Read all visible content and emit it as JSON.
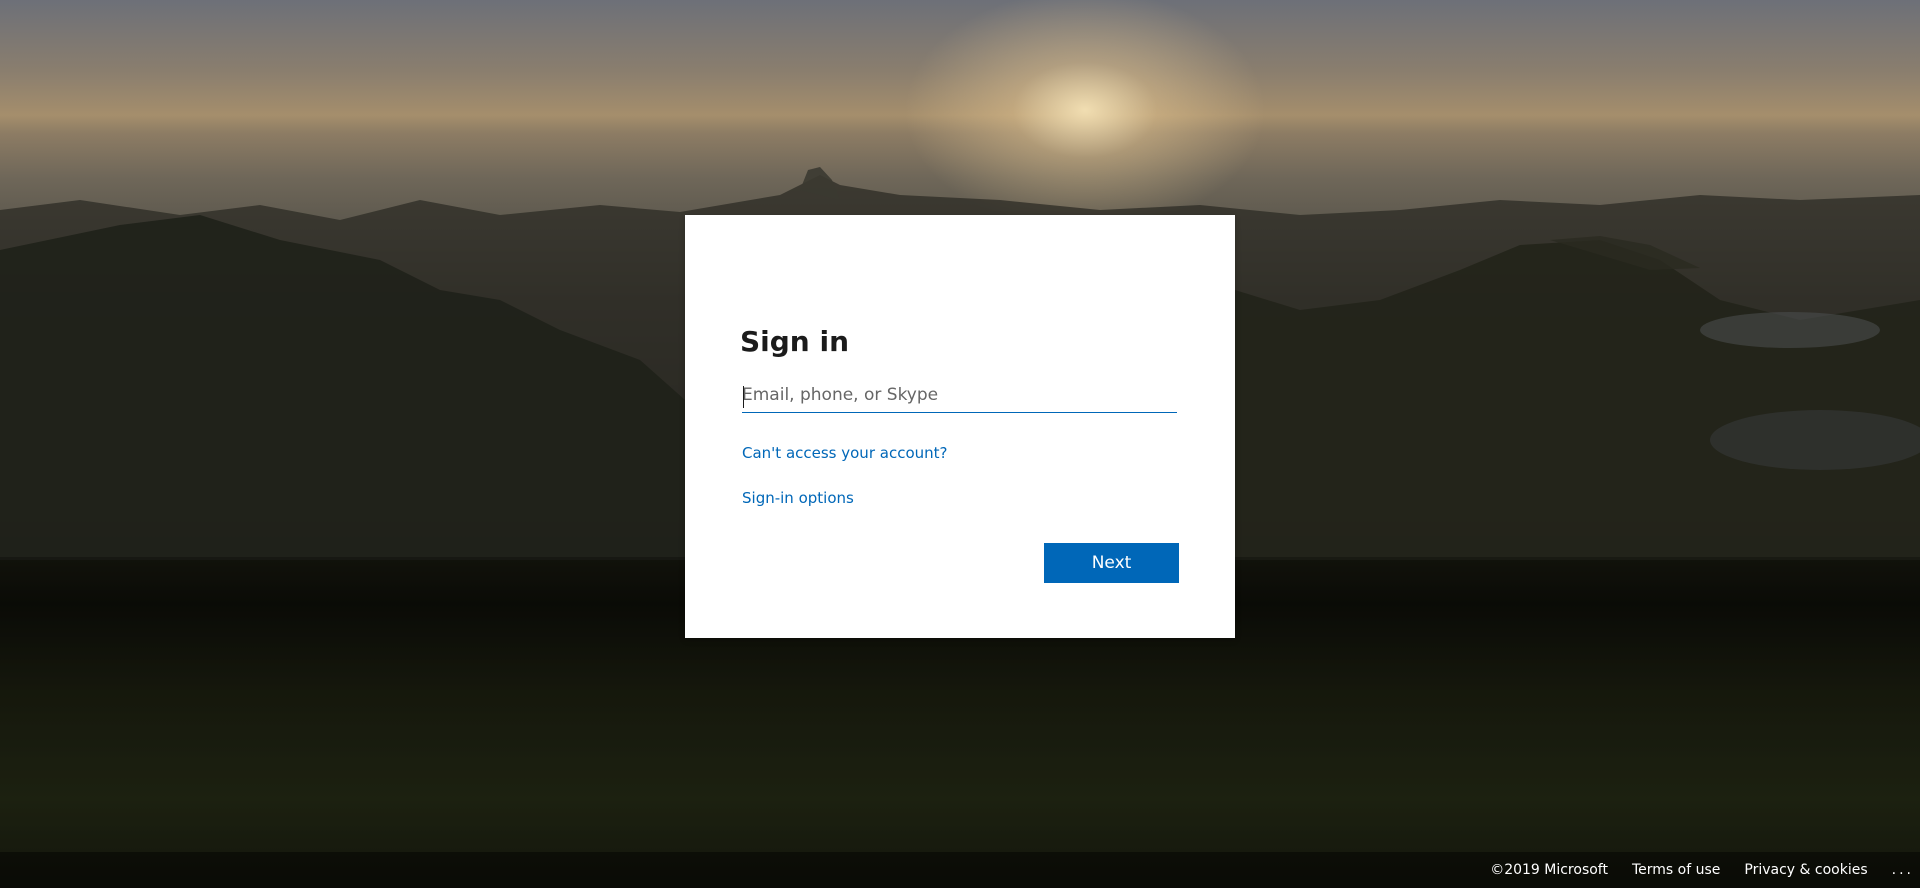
{
  "signin": {
    "title": "Sign in",
    "email_placeholder": "Email, phone, or Skype",
    "email_value": "",
    "cant_access_link": "Can't access your account?",
    "signin_options_link": "Sign-in options",
    "next_button": "Next"
  },
  "footer": {
    "copyright": "©2019 Microsoft",
    "terms": "Terms of use",
    "privacy": "Privacy & cookies",
    "more": "..."
  },
  "colors": {
    "accent": "#0067b8",
    "card_background": "#ffffff",
    "title_text": "#1b1b1b"
  }
}
